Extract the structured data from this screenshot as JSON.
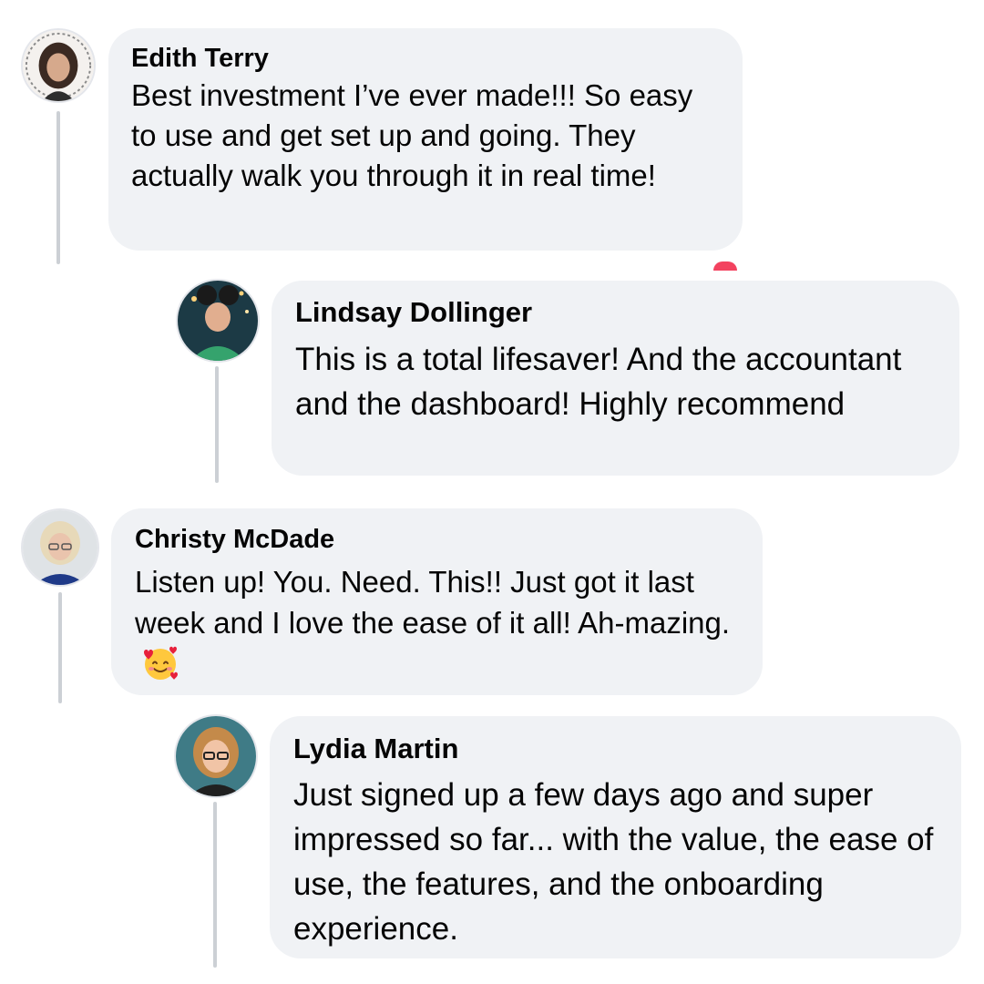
{
  "comments": [
    {
      "author": "Edith Terry",
      "text": "Best investment I’ve ever made!!! So easy to use and get set up and going. They actually walk you through it in real time!",
      "avatar_icon": "profile-photo"
    },
    {
      "author": "Lindsay Dollinger",
      "text": "This is a total lifesaver! And the accountant and the dashboard! Highly recommend",
      "avatar_icon": "profile-photo"
    },
    {
      "author": "Christy McDade",
      "text": "Listen up! You. Need. This!! Just got it last week and I love the ease of it all! Ah-mazing.",
      "emoji": "smiling-face-with-hearts-icon",
      "avatar_icon": "profile-photo"
    },
    {
      "author": "Lydia Martin",
      "text": "Just signed up a few days ago and super impressed so far... with the value, the ease of use, the features, and the onboarding experience.",
      "avatar_icon": "profile-photo"
    }
  ],
  "colors": {
    "bubble": "#f0f2f5",
    "thread_line": "#ccd0d5",
    "text": "#050505",
    "reaction": "#f3425f"
  }
}
